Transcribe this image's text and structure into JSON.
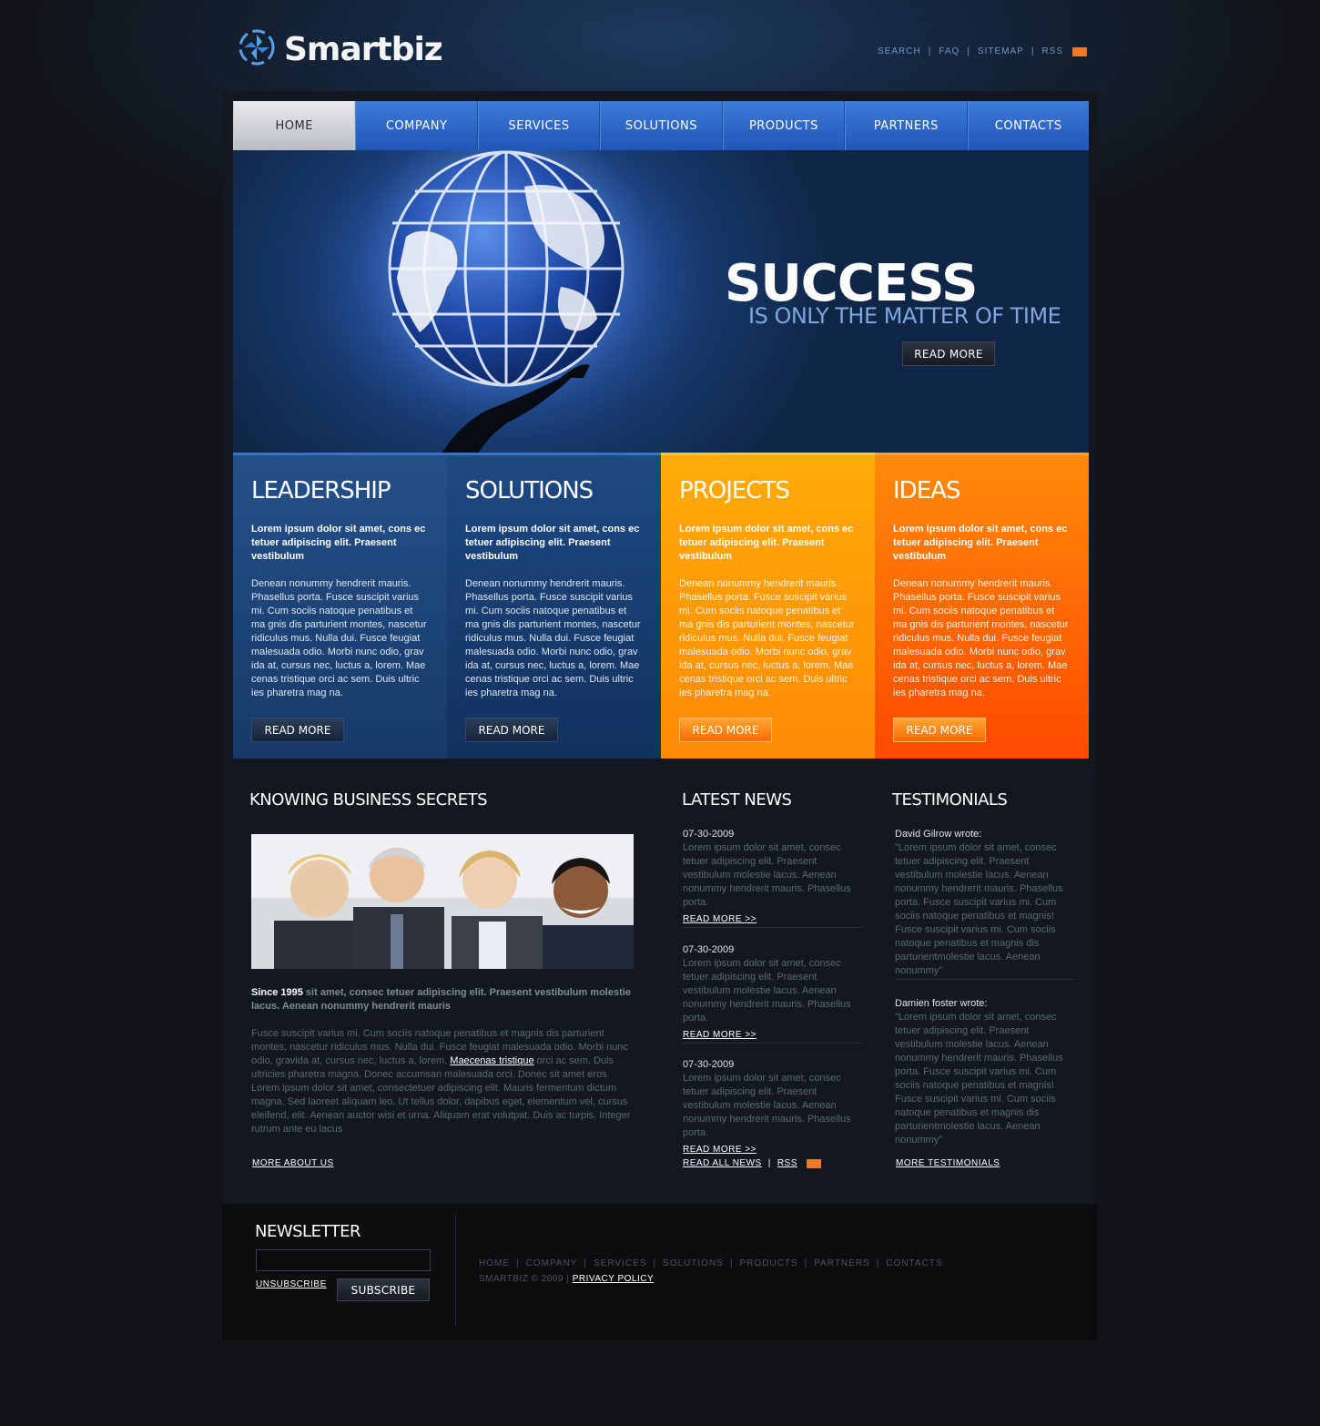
{
  "brand": {
    "name": "Smartbiz"
  },
  "top_links": [
    "SEARCH",
    "FAQ",
    "SITEMAP",
    "RSS"
  ],
  "nav": [
    "HOME",
    "COMPANY",
    "SERVICES",
    "SOLUTIONS",
    "PRODUCTS",
    "PARTNERS",
    "CONTACTS"
  ],
  "nav_active": "HOME",
  "hero": {
    "title": "SUCCESS",
    "subtitle": "IS ONLY THE MATTER OF TIME",
    "button": "READ MORE"
  },
  "features": [
    {
      "title": "LEADERSHIP",
      "lead": "Lorem ipsum dolor sit amet, cons ec tetuer adipiscing elit. Praesent vestibulum",
      "body": "Denean nonummy hendrerit mauris. Phasellus porta. Fusce suscipit varius mi. Cum sociis natoque penatibus et ma gnis dis parturient montes, nascetur ridiculus mus. Nulla dui. Fusce feugiat malesuada odio. Morbi nunc odio, grav ida at, cursus nec, luctus a, lorem. Mae cenas tristique orci ac sem. Duis ultric ies pharetra mag na.",
      "button": "READ MORE"
    },
    {
      "title": "SOLUTIONS",
      "lead": "Lorem ipsum dolor sit amet, cons ec tetuer adipiscing elit. Praesent vestibulum",
      "body": "Denean nonummy hendrerit mauris. Phasellus porta. Fusce suscipit varius mi. Cum sociis natoque penatibus et ma gnis dis parturient montes, nascetur ridiculus mus. Nulla dui. Fusce feugiat malesuada odio. Morbi nunc odio, grav ida at, cursus nec, luctus a, lorem. Mae cenas tristique orci ac sem. Duis ultric ies pharetra mag na.",
      "button": "READ MORE"
    },
    {
      "title": "PROJECTS",
      "lead": "Lorem ipsum dolor sit amet, cons ec tetuer adipiscing elit. Praesent vestibulum",
      "body": "Denean nonummy hendrerit mauris. Phasellus porta. Fusce suscipit varius mi. Cum sociis natoque penatibus et ma gnis dis parturient montes, nascetur ridiculus mus. Nulla dui. Fusce feugiat malesuada odio. Morbi nunc odio, grav ida at, cursus nec, luctus a, lorem. Mae cenas tristique orci ac sem. Duis ultric ies pharetra mag na.",
      "button": "READ MORE"
    },
    {
      "title": "IDEAS",
      "lead": "Lorem ipsum dolor sit amet, cons ec tetuer adipiscing elit. Praesent vestibulum",
      "body": "Denean nonummy hendrerit mauris. Phasellus porta. Fusce suscipit varius mi. Cum sociis natoque penatibus et ma gnis dis parturient montes, nascetur ridiculus mus. Nulla dui. Fusce feugiat malesuada odio. Morbi nunc odio, grav ida at, cursus nec, luctus a, lorem. Mae cenas tristique orci ac sem. Duis ultric ies pharetra mag na.",
      "button": "READ MORE"
    }
  ],
  "secrets": {
    "title": "KNOWING BUSINESS SECRETS",
    "since_bold": "Since 1995",
    "since_rest": " sit amet, consec tetuer adipiscing elit. Praesent vestibulum molestie lacus. Aenean nonummy hendrerit mauris",
    "body_before": "Fusce suscipit varius mi. Cum sociis natoque penatibus et magnis dis parturient montes, nascetur ridiculus mus. Nulla dui. Fusce feugiat malesuada odio. Morbi nunc odio, gravida at, cursus nec, luctus a, lorem. ",
    "body_link": "Maecenas tristique",
    "body_after": " orci ac sem. Duis ultricies pharetra magna. Donec accumsan malesuada orci. Donec sit amet eros. Lorem ipsum dolor sit amet, consectetuer adipiscing elit. Mauris fermentum dictum magna. Sed laoreet aliquam leo. Ut tellus dolor, dapibus eget, elementum vel, cursus eleifend, elit. Aenean auctor wisi et urna. Aliquam erat volutpat. Duis ac turpis. Integer rutrum ante eu lacus",
    "more": "MORE ABOUT US"
  },
  "news": {
    "title": "LATEST NEWS",
    "items": [
      {
        "date": "07-30-2009",
        "text": "Lorem ipsum dolor sit amet, consec tetuer adipiscing elit. Praesent vestibulum molestie lacus. Aenean nonummy hendrerit mauris. Phasellus porta.",
        "more": "READ MORE >>"
      },
      {
        "date": "07-30-2009",
        "text": "Lorem ipsum dolor sit amet, consec tetuer adipiscing elit. Praesent vestibulum molestie lacus. Aenean nonummy hendrerit mauris. Phasellus porta.",
        "more": "READ MORE >>"
      },
      {
        "date": "07-30-2009",
        "text": "Lorem ipsum dolor sit amet, consec tetuer adipiscing elit. Praesent vestibulum molestie lacus. Aenean nonummy hendrerit mauris. Phasellus porta.",
        "more": "READ MORE >>"
      }
    ],
    "read_all": "READ ALL NEWS",
    "rss": "RSS"
  },
  "testimonials": {
    "title": "TESTIMONIALS",
    "items": [
      {
        "name": "David Gilrow wrote:",
        "text": "\"Lorem ipsum dolor sit amet, consec tetuer adipiscing elit. Praesent vestibulum molestie lacus. Aenean nonummy hendrerit mauris. Phasellus porta.  Fusce suscipit varius mi. Cum sociis natoque penatibus et magnis! Fusce suscipit varius mi. Cum sociis natoque penatibus et magnis dis parturientmolestie lacus. Aenean nonummy\""
      },
      {
        "name": "Damien foster wrote:",
        "text": "\"Lorem ipsum dolor sit amet, consec tetuer adipiscing elit. Praesent vestibulum molestie lacus. Aenean nonummy hendrerit mauris. Phasellus porta.  Fusce suscipit varius mi. Cum sociis natoque penatibus et magnis! Fusce suscipit varius mi. Cum sociis natoque penatibus et magnis dis parturientmolestie lacus. Aenean nonummy\""
      }
    ],
    "more": "MORE TESTIMONIALS"
  },
  "newsletter": {
    "title": "NEWSLETTER",
    "input_value": "",
    "unsubscribe": "UNSUBSCRIBE",
    "subscribe": "SUBSCRIBE"
  },
  "footer": {
    "nav": [
      "HOME",
      "COMPANY",
      "SERVICES",
      "SOLUTIONS",
      "PRODUCTS",
      "PARTNERS",
      "CONTACTS"
    ],
    "copyright": "SMARTBIZ © 2009 |",
    "privacy": "PRIVACY POLICY"
  },
  "colors": {
    "nav_blue": "#2f6fd0",
    "accent_orange": "#ff8a06",
    "background": "#121417"
  }
}
